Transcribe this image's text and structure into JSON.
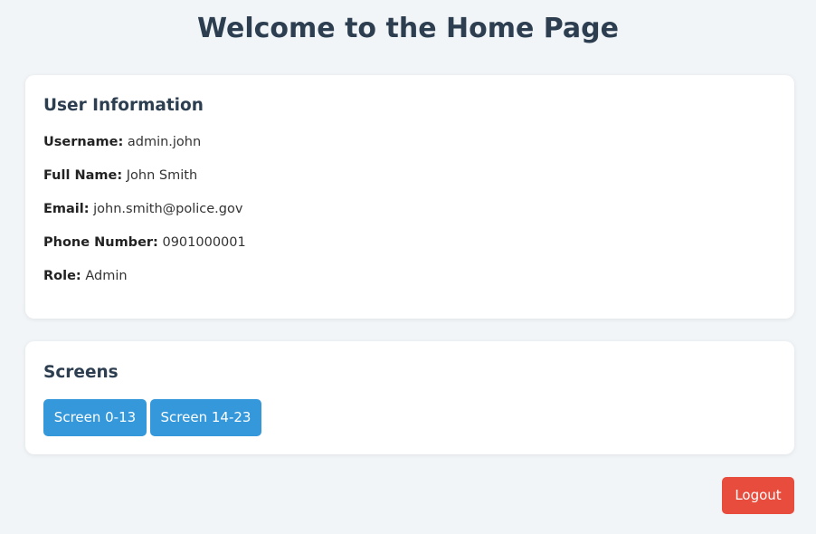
{
  "header": {
    "title": "Welcome to the Home Page"
  },
  "user_info": {
    "heading": "User Information",
    "fields": [
      {
        "label": "Username:",
        "value": "admin.john"
      },
      {
        "label": "Full Name:",
        "value": "John Smith"
      },
      {
        "label": "Email:",
        "value": "john.smith@police.gov"
      },
      {
        "label": "Phone Number:",
        "value": "0901000001"
      },
      {
        "label": "Role:",
        "value": "Admin"
      }
    ]
  },
  "screens": {
    "heading": "Screens",
    "buttons": [
      {
        "label": "Screen 0-13"
      },
      {
        "label": "Screen 14-23"
      }
    ]
  },
  "actions": {
    "logout_label": "Logout"
  },
  "colors": {
    "background": "#f2f5f8",
    "heading": "#2c3e50",
    "primary_button": "#3498db",
    "danger_button": "#e74c3c"
  }
}
